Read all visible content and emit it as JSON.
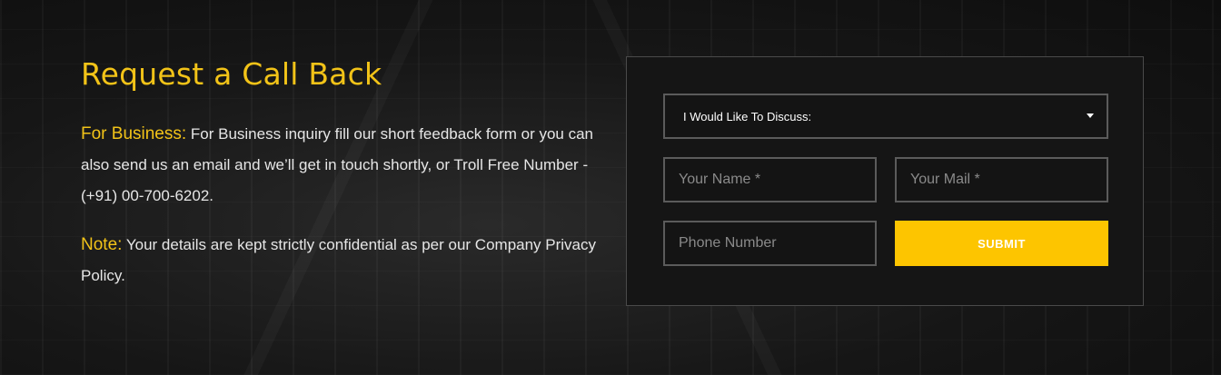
{
  "section": {
    "title": "Request a Call Back",
    "business_label": "For Business:",
    "business_text": " For Business inquiry fill our short feedback form or you can also send us an email and we’ll get in touch shortly, or Troll Free Number - (+91) 00-700-6202.",
    "note_label": "Note:",
    "note_text": " Your details are kept strictly confidential as per our Company Privacy Policy."
  },
  "form": {
    "discuss_select": "I Would Like To Discuss:",
    "name_placeholder": "Your Name *",
    "mail_placeholder": "Your Mail *",
    "phone_placeholder": "Phone Number",
    "submit_label": "SUBMIT"
  },
  "colors": {
    "accent": "#f2c318",
    "button": "#fdc500"
  }
}
